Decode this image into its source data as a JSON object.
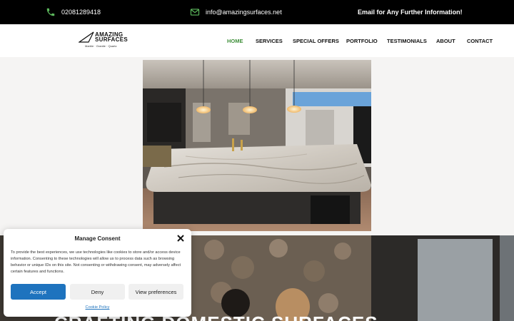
{
  "topbar": {
    "phone": "02081289418",
    "email": "info@amazingsurfaces.net",
    "info": "Email for Any Further Information!"
  },
  "header": {
    "logo_line1": "AMAZING",
    "logo_line2": "SURFACES",
    "logo_tagline": "Marble · Granite · Quartz",
    "nav": [
      {
        "label": "HOME",
        "active": true
      },
      {
        "label": "SERVICES",
        "active": false
      },
      {
        "label": "SPECIAL OFFERS",
        "active": false
      },
      {
        "label": "PORTFOLIO",
        "active": false
      },
      {
        "label": "TESTIMONIALS",
        "active": false
      },
      {
        "label": "ABOUT",
        "active": false
      },
      {
        "label": "CONTACT",
        "active": false
      }
    ]
  },
  "lower": {
    "heading": "CRAFTING DOMESTIC SURFACES"
  },
  "consent": {
    "title": "Manage Consent",
    "text": "To provide the best experiences, we use technologies like cookies to store and/or access device information. Consenting to these technologies will allow us to process data such as browsing behavior or unique IDs on this site. Not consenting or withdrawing consent, may adversely affect certain features and functions.",
    "accept_label": "Accept",
    "deny_label": "Deny",
    "prefs_label": "View preferences",
    "policy_label": "Cookie Policy"
  },
  "colors": {
    "accent_green": "#3f8f3a",
    "button_blue": "#1e73be",
    "topbar_bg": "#000000"
  },
  "icons": {
    "phone": "phone-icon",
    "email": "envelope-icon",
    "close": "close-icon"
  }
}
